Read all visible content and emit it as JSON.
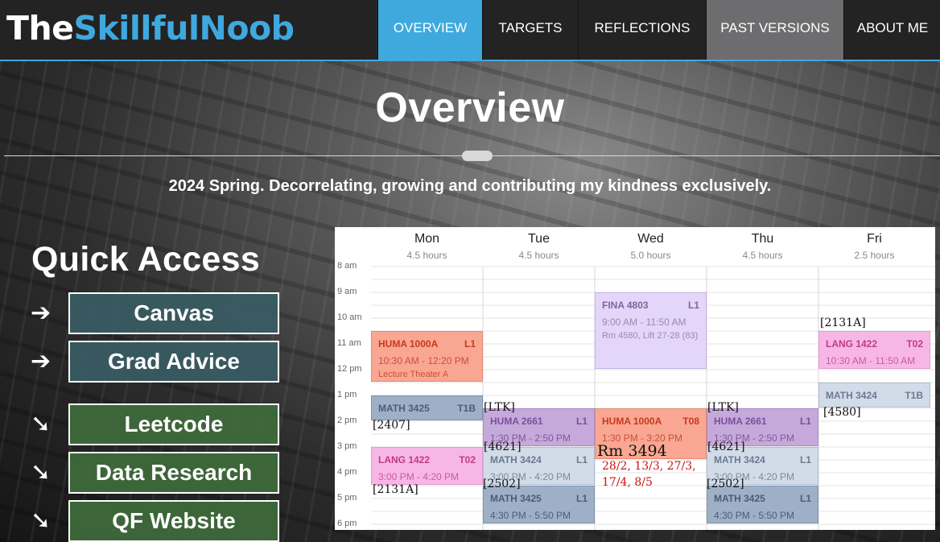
{
  "brand": {
    "part1": "The",
    "part2": "SkillfulNoob"
  },
  "nav": [
    {
      "label": "OVERVIEW",
      "state": "active"
    },
    {
      "label": "TARGETS",
      "state": ""
    },
    {
      "label": "REFLECTIONS",
      "state": ""
    },
    {
      "label": "PAST VERSIONS",
      "state": "muted"
    },
    {
      "label": "ABOUT ME",
      "state": ""
    }
  ],
  "page": {
    "title": "Overview",
    "subtitle": "2024 Spring. Decorrelating, growing and contributing my kindness exclusively."
  },
  "quick_access": {
    "heading": "Quick Access",
    "links": [
      {
        "label": "Canvas",
        "arrow": "➔",
        "style": "teal"
      },
      {
        "label": "Grad Advice",
        "arrow": "➔",
        "style": "teal"
      },
      {
        "label": "Leetcode",
        "arrow": "➘",
        "style": "green"
      },
      {
        "label": "Data Research",
        "arrow": "➘",
        "style": "green"
      },
      {
        "label": "QF Website",
        "arrow": "➘",
        "style": "green"
      }
    ]
  },
  "calendar": {
    "days": [
      {
        "name": "Mon",
        "hours": "4.5 hours"
      },
      {
        "name": "Tue",
        "hours": "4.5 hours"
      },
      {
        "name": "Wed",
        "hours": "5.0 hours"
      },
      {
        "name": "Thu",
        "hours": "4.5 hours"
      },
      {
        "name": "Fri",
        "hours": "2.5 hours"
      }
    ],
    "times": [
      "8 am",
      "9 am",
      "10 am",
      "11 am",
      "12 pm",
      "1 pm",
      "2 pm",
      "3 pm",
      "4 pm",
      "5 pm",
      "6 pm"
    ],
    "events": {
      "mon_huma": {
        "code": "HUMA 1000A",
        "sec": "L1",
        "time": "10:30 AM - 12:20 PM",
        "loc": "Lecture Theater A"
      },
      "mon_math": {
        "code": "MATH 3425",
        "sec": "T1B"
      },
      "mon_lang": {
        "code": "LANG 1422",
        "sec": "T02",
        "time": "3:00 PM - 4:20 PM"
      },
      "tue_huma": {
        "code": "HUMA 2661",
        "sec": "L1",
        "time": "1:30 PM - 2:50 PM"
      },
      "tue_math3424": {
        "code": "MATH 3424",
        "sec": "L1",
        "time": "3:00 PM - 4:20 PM"
      },
      "tue_math3425": {
        "code": "MATH 3425",
        "sec": "L1",
        "time": "4:30 PM - 5:50 PM"
      },
      "wed_fina": {
        "code": "FINA 4803",
        "sec": "L1",
        "time": "9:00 AM - 11:50 AM",
        "loc": "Rm 4580, Lift 27-28 (83)"
      },
      "wed_huma": {
        "code": "HUMA 1000A",
        "sec": "T08",
        "time": "1:30 PM - 3:20 PM"
      },
      "thu_huma": {
        "code": "HUMA 2661",
        "sec": "L1",
        "time": "1:30 PM - 2:50 PM"
      },
      "thu_math3424": {
        "code": "MATH 3424",
        "sec": "L1",
        "time": "3:00 PM - 4:20 PM"
      },
      "thu_math3425": {
        "code": "MATH 3425",
        "sec": "L1",
        "time": "4:30 PM - 5:50 PM"
      },
      "fri_lang": {
        "code": "LANG 1422",
        "sec": "T02",
        "time": "10:30 AM - 11:50 AM"
      },
      "fri_math": {
        "code": "MATH 3424",
        "sec": "T1B"
      }
    },
    "annotations": {
      "mon_2407": "[2407]",
      "mon_2131a": "[2131A]",
      "tue_ltk": "[LTK]",
      "tue_4621": "[4621]",
      "tue_2502": "[2502]",
      "wed_rm": "Rm 3494",
      "wed_dates1": "28/2, 13/3, 27/3,",
      "wed_dates2": "17/4, 8/5",
      "thu_ltk": "[LTK]",
      "thu_4621": "[4621]",
      "thu_2502": "[2502]",
      "fri_2131a": "[2131A]",
      "fri_4580": "[4580]"
    }
  }
}
